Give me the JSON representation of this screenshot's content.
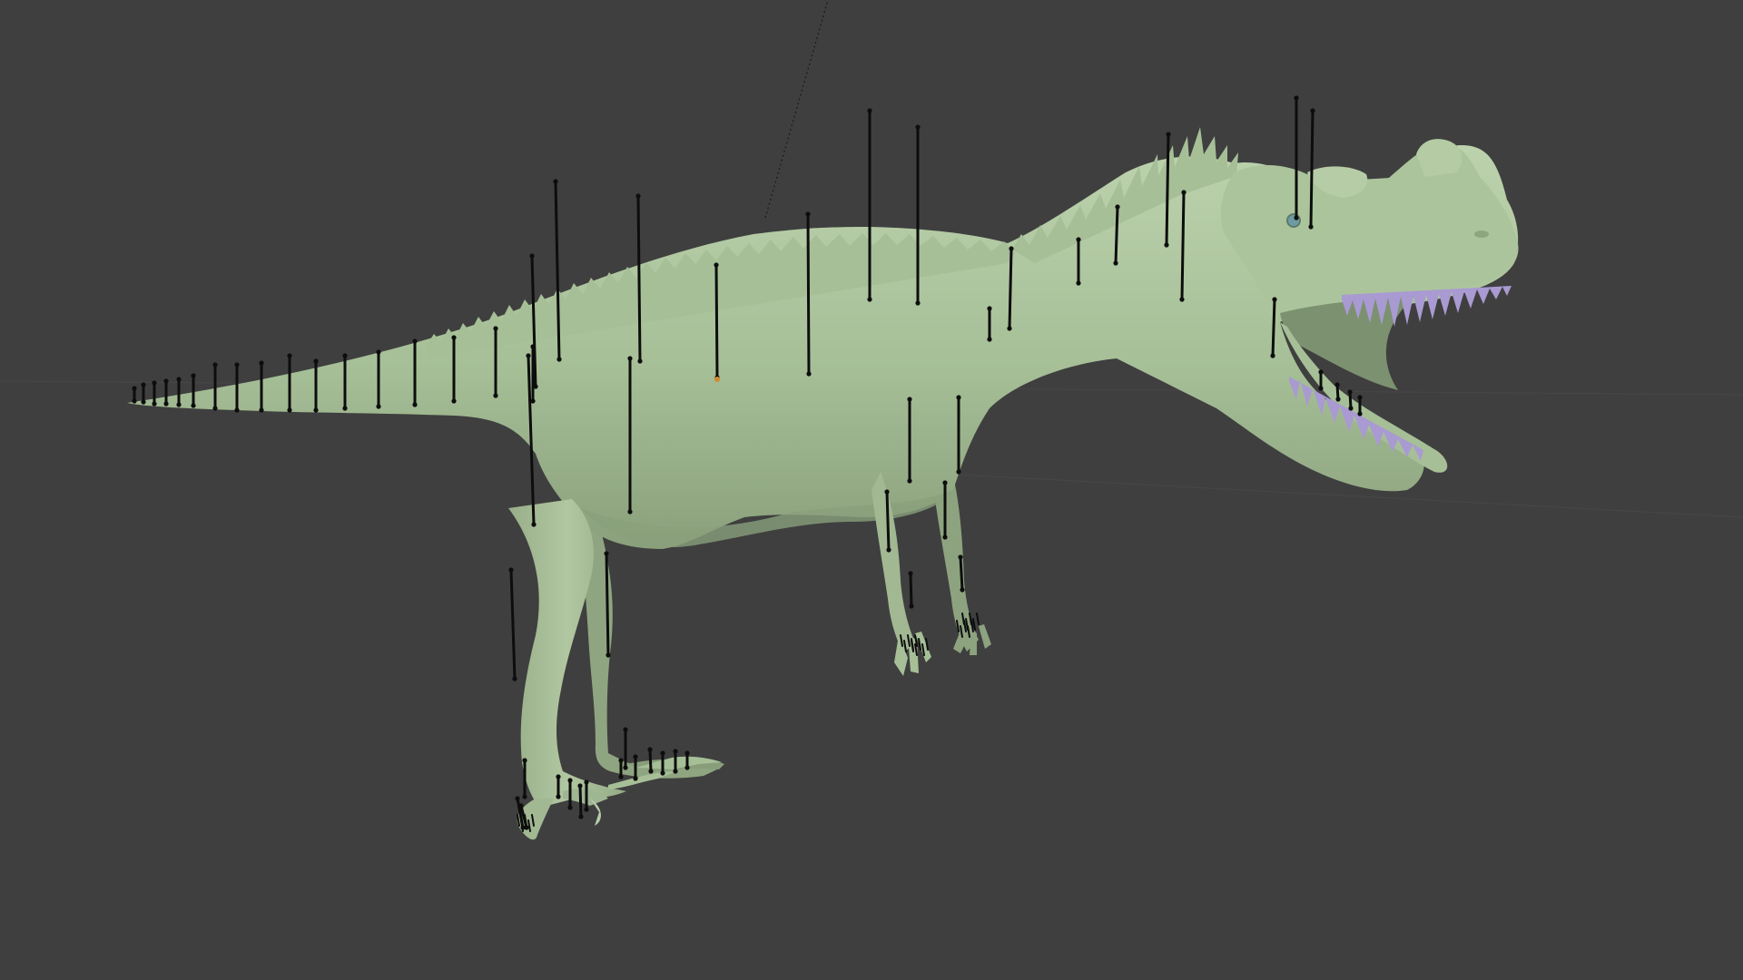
{
  "viewport": {
    "background_color": "#3f3f3f",
    "grid_line_color": "#4a4a4a",
    "relationship_line_color": "#1a1a1a"
  },
  "model": {
    "body_color": "#a6bf97",
    "body_shade_color": "#8ea580",
    "body_highlight_color": "#c1d6b2",
    "teeth_color": "#a99ad2",
    "eye_color": "#6e9ba3"
  },
  "armature": {
    "bone_color": "#0d0d0d",
    "active_joint_color": "#d18a32"
  }
}
